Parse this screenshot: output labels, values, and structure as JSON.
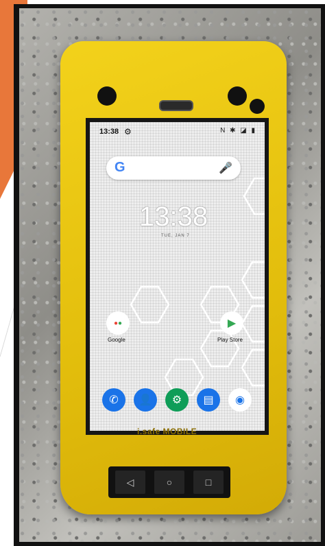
{
  "screen": {
    "status_time": "13:38",
    "status_icons": "N ✱ ◪ ▮",
    "clock": "13:38",
    "date": "TUE, JAN 7",
    "search_logo": "G",
    "apps": [
      {
        "label": "Google",
        "icon": "google-apps-folder-icon"
      },
      {
        "label": "Play Store",
        "icon": "play-store-icon"
      }
    ],
    "dock": [
      {
        "icon": "phone-icon",
        "color": "#1a73e8"
      },
      {
        "icon": "contacts-icon",
        "color": "#1a73e8"
      },
      {
        "icon": "settings-icon",
        "color": "#0f9d58"
      },
      {
        "icon": "messages-icon",
        "color": "#1a73e8"
      },
      {
        "icon": "camera-icon",
        "color": "#1a73e8"
      }
    ]
  },
  "device": {
    "brand": "i.safe MOBILE"
  },
  "colors": {
    "case": "#e8c310",
    "slide_accent": "#e8773a"
  }
}
